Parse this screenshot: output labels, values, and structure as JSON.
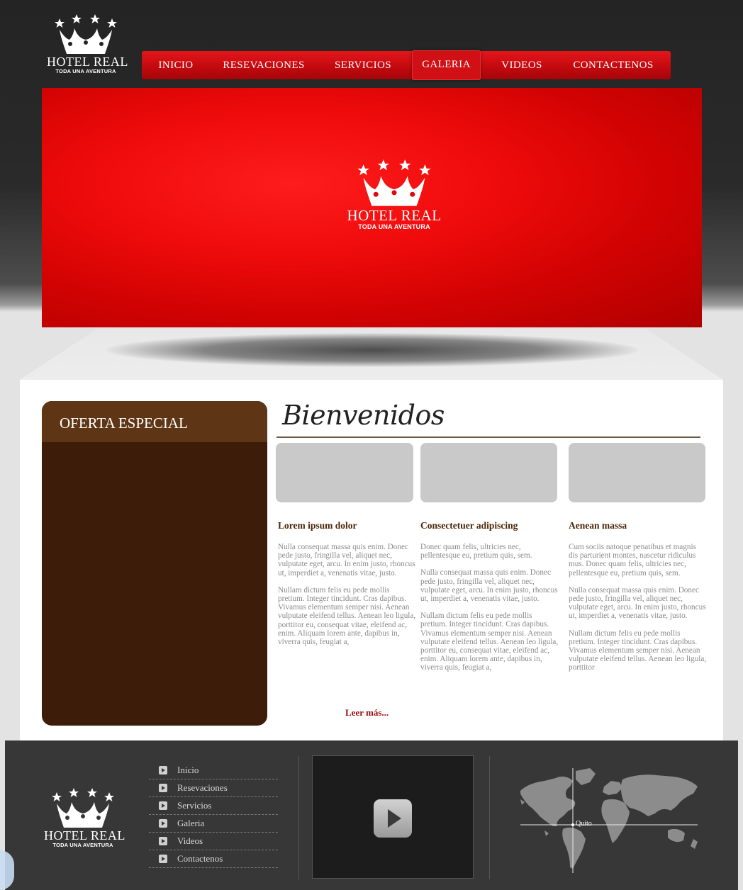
{
  "brand": {
    "name": "HOTEL REAL",
    "tagline": "TODA UNA AVENTURA"
  },
  "nav": {
    "items": [
      {
        "label": "INICIO"
      },
      {
        "label": "RESEVACIONES"
      },
      {
        "label": "SERVICIOS"
      },
      {
        "label": "GALERIA",
        "active": true
      },
      {
        "label": "VIDEOS"
      },
      {
        "label": "CONTACTENOS"
      }
    ]
  },
  "offer": {
    "title": "OFERTA ESPECIAL"
  },
  "welcome": {
    "title": "Bienvenidos"
  },
  "columns": [
    {
      "title": "Lorem ipsum dolor",
      "paragraphs": [
        "Nulla consequat massa quis enim. Donec pede justo, fringilla vel, aliquet nec, vulputate eget, arcu. In enim justo, rhoncus ut, imperdiet a, venenatis vitae, justo.",
        "Nullam dictum felis eu pede mollis pretium. Integer tincidunt. Cras dapibus. Vivamus elementum semper nisi. Aenean vulputate eleifend tellus. Aenean leo ligula, porttitor eu, consequat vitae, eleifend ac, enim. Aliquam lorem ante, dapibus in, viverra quis, feugiat a,"
      ]
    },
    {
      "title": "Consectetuer adipiscing",
      "paragraphs": [
        "Donec quam felis, ultricies nec, pellentesque eu, pretium quis, sem.",
        "Nulla consequat massa quis enim. Donec pede justo, fringilla vel, aliquet nec, vulputate eget, arcu. In enim justo, rhoncus ut, imperdiet a, venenatis vitae, justo.",
        "Nullam dictum felis eu pede mollis pretium. Integer tincidunt. Cras dapibus. Vivamus elementum semper nisi. Aenean vulputate eleifend tellus. Aenean leo ligula, porttitor eu, consequat vitae, eleifend ac, enim. Aliquam lorem ante, dapibus in, viverra quis, feugiat a,"
      ]
    },
    {
      "title": "Aenean massa",
      "paragraphs": [
        "Cum sociis natoque penatibus et magnis dis parturient montes, nascetur ridiculus mus. Donec quam felis, ultricies nec, pellentesque eu, pretium quis, sem.",
        "Nulla consequat massa quis enim. Donec pede justo, fringilla vel, aliquet nec, vulputate eget, arcu. In enim justo, rhoncus ut, imperdiet a, venenatis vitae, justo.",
        "Nullam dictum felis eu pede mollis pretium. Integer tincidunt. Cras dapibus. Vivamus elementum semper nisi. Aenean vulputate eleifend tellus. Aenean leo ligula, porttitor"
      ]
    }
  ],
  "read_more": "Leer más...",
  "footer": {
    "links": [
      "Inicio",
      "Resevaciones",
      "Servicios",
      "Galeria",
      "Videos",
      "Contactenos"
    ],
    "map_label": "Quito",
    "icons": {
      "bullet": "play-bullet-icon",
      "video": "play-icon",
      "map": "world-map-icon"
    }
  },
  "colors": {
    "nav_red": "#c40a0f",
    "hero_red": "#e00000",
    "offer_brown": "#3d1d0a",
    "offer_head": "#5e3615",
    "title_brown": "#4a2608",
    "read_more": "#9d0a0a",
    "footer_bg": "#373737"
  }
}
